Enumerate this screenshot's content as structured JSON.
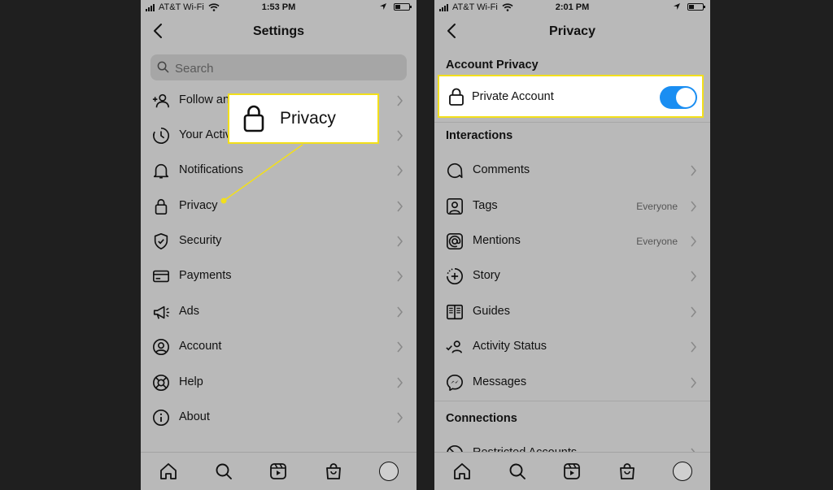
{
  "colors": {
    "toggle_on": "#1a8ef2",
    "highlight_border": "#f2df1b",
    "pointer": "#f2df1b"
  },
  "left": {
    "status": {
      "carrier": "AT&T Wi-Fi",
      "time": "1:53 PM"
    },
    "title": "Settings",
    "search": {
      "placeholder": "Search"
    },
    "items": [
      {
        "label": "Follow and Invite Friends",
        "icon": "add-person-icon"
      },
      {
        "label": "Your Activity",
        "icon": "activity-clock-icon"
      },
      {
        "label": "Notifications",
        "icon": "bell-icon"
      },
      {
        "label": "Privacy",
        "icon": "lock-icon"
      },
      {
        "label": "Security",
        "icon": "shield-icon"
      },
      {
        "label": "Payments",
        "icon": "card-icon"
      },
      {
        "label": "Ads",
        "icon": "megaphone-icon"
      },
      {
        "label": "Account",
        "icon": "account-circle-icon"
      },
      {
        "label": "Help",
        "icon": "lifebuoy-icon"
      },
      {
        "label": "About",
        "icon": "info-icon"
      }
    ],
    "callout": {
      "label": "Privacy",
      "icon": "lock-icon"
    }
  },
  "right": {
    "status": {
      "carrier": "AT&T Wi-Fi",
      "time": "2:01 PM"
    },
    "title": "Privacy",
    "account_privacy": {
      "heading": "Account Privacy",
      "private_account_label": "Private Account",
      "private_account_on": true
    },
    "interactions": {
      "heading": "Interactions",
      "items": [
        {
          "label": "Comments",
          "value": "",
          "icon": "comment-bubble-icon"
        },
        {
          "label": "Tags",
          "value": "Everyone",
          "icon": "tag-person-icon"
        },
        {
          "label": "Mentions",
          "value": "Everyone",
          "icon": "at-sign-icon"
        },
        {
          "label": "Story",
          "value": "",
          "icon": "story-plus-icon"
        },
        {
          "label": "Guides",
          "value": "",
          "icon": "guides-book-icon"
        },
        {
          "label": "Activity Status",
          "value": "",
          "icon": "activity-status-icon"
        },
        {
          "label": "Messages",
          "value": "",
          "icon": "messenger-icon"
        }
      ]
    },
    "connections": {
      "heading": "Connections",
      "items": [
        {
          "label": "Restricted Accounts",
          "icon": "restricted-icon"
        }
      ]
    }
  },
  "tabbar": [
    "home-icon",
    "search-icon",
    "reels-icon",
    "shop-icon",
    "profile-avatar"
  ]
}
